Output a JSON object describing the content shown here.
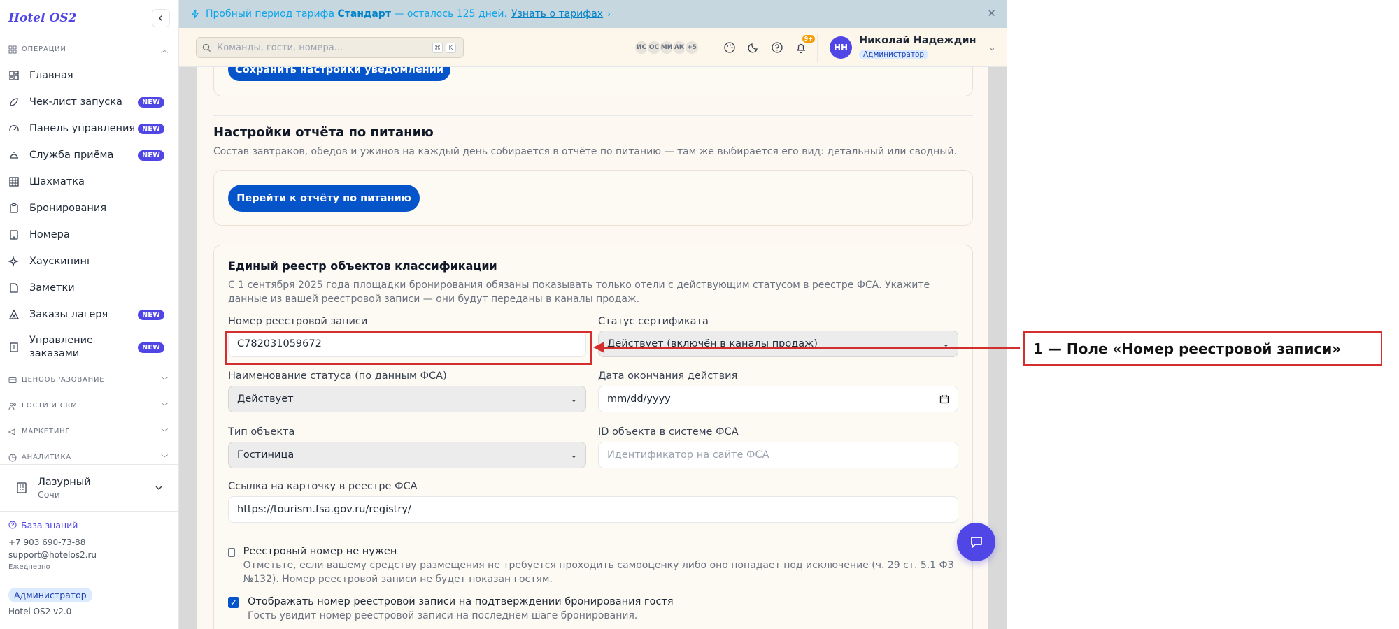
{
  "sidebar": {
    "brand": "Hotel OS2",
    "groups": [
      {
        "label": "ОПЕРАЦИИ"
      },
      {
        "label": "ЦЕНООБРАЗОВАНИЕ"
      },
      {
        "label": "ГОСТИ И CRM"
      },
      {
        "label": "МАРКЕТИНГ"
      },
      {
        "label": "АНАЛИТИКА"
      }
    ],
    "items": [
      {
        "label": "Главная",
        "badge": ""
      },
      {
        "label": "Чек-лист запуска",
        "badge": "NEW"
      },
      {
        "label": "Панель управления",
        "badge": "NEW"
      },
      {
        "label": "Служба приёма",
        "badge": "NEW"
      },
      {
        "label": "Шахматка",
        "badge": ""
      },
      {
        "label": "Бронирования",
        "badge": ""
      },
      {
        "label": "Номера",
        "badge": ""
      },
      {
        "label": "Хаускипинг",
        "badge": ""
      },
      {
        "label": "Заметки",
        "badge": ""
      },
      {
        "label": "Заказы лагеря",
        "badge": "NEW"
      },
      {
        "label": "Управление заказами",
        "badge": "NEW"
      }
    ],
    "hotel": {
      "name": "Лазурный",
      "city": "Сочи"
    },
    "footer": {
      "knowledge_base": "База знаний",
      "phone": "+7 903 690-73-88",
      "email": "support@hotelos2.ru",
      "hours": "Ежедневно",
      "role": "Администратор",
      "version": "Hotel OS2 v2.0"
    }
  },
  "banner": {
    "prefix": "Пробный период тарифа",
    "plan": "Стандарт",
    "remaining": "— осталось 125 дней.",
    "link": "Узнать о тарифах"
  },
  "header": {
    "search_placeholder": "Команды, гости, номера...",
    "shortcut_keys": [
      "⌘",
      "K"
    ],
    "presence": [
      "ИС",
      "ОС",
      "МИ",
      "АК",
      "+5"
    ],
    "notifications_count": "9+",
    "user": {
      "initials": "НН",
      "name": "Николай Надеждин",
      "role": "Администратор"
    }
  },
  "main": {
    "save_notifications_button": "Сохранить настройки уведомлений",
    "meal_report": {
      "title": "Настройки отчёта по питанию",
      "description": "Состав завтраков, обедов и ужинов на каждый день собирается в отчёте по питанию — там же выбирается его вид: детальный или сводный.",
      "button": "Перейти к отчёту по питанию"
    },
    "registry": {
      "title": "Единый реестр объектов классификации",
      "description": "С 1 сентября 2025 года площадки бронирования обязаны показывать только отели с действующим статусом в реестре ФСА. Укажите данные из вашей реестровой записи — они будут переданы в каналы продаж.",
      "record_number_label": "Номер реестровой записи",
      "record_number_value": "C782031059672",
      "certificate_status_label": "Статус сертификата",
      "certificate_status_value": "Действует (включён в каналы продаж)",
      "status_name_label": "Наименование статуса (по данным ФСА)",
      "status_name_value": "Действует",
      "expiry_label": "Дата окончания действия",
      "expiry_value": "mm/dd/yyyy",
      "object_type_label": "Тип объекта",
      "object_type_value": "Гостиница",
      "fsa_id_label": "ID объекта в системе ФСА",
      "fsa_id_placeholder": "Идентификатор на сайте ФСА",
      "card_link_label": "Ссылка на карточку в реестре ФСА",
      "card_link_value": "https://tourism.fsa.gov.ru/registry/",
      "no_number_title": "Реестровый номер не нужен",
      "no_number_desc": "Отметьте, если вашему средству размещения не требуется проходить самооценку либо оно попадает под исключение (ч. 29 ст. 5.1 ФЗ №132). Номер реестровой записи не будет показан гостям.",
      "no_number_checked": false,
      "show_number_title": "Отображать номер реестровой записи на подтверждении бронирования гостя",
      "show_number_desc": "Гость увидит номер реестровой записи на последнем шаге бронирования.",
      "show_number_checked": true
    }
  },
  "annotation": {
    "label": "1 — Поле «Номер реестровой записи»",
    "color": "#d32f2f"
  },
  "colors": {
    "accent": "#4f46e5",
    "primary_button": "#0654c9",
    "banner_bg": "#c7d7e0"
  }
}
